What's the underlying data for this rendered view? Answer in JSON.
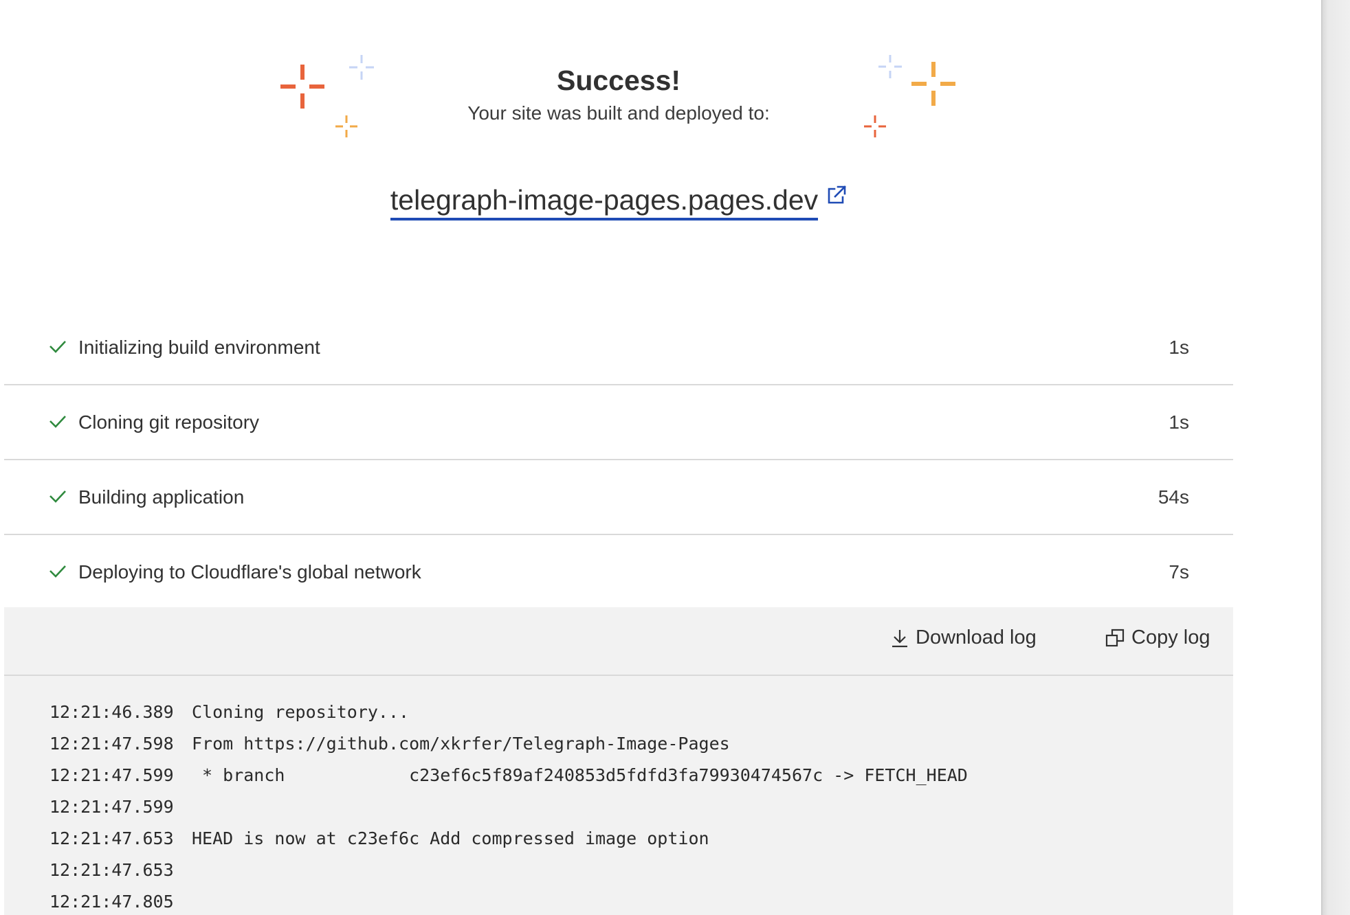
{
  "header": {
    "title": "Success!",
    "subtitle": "Your site was built and deployed to:",
    "url": "telegraph-image-pages.pages.dev",
    "sparkle_colors": {
      "orange_red": "#e8643c",
      "amber": "#f2aa48",
      "light_blue": "#c6d4f5"
    },
    "link_underline_color": "#1f4bb5"
  },
  "steps": [
    {
      "label": "Initializing build environment",
      "time": "1s",
      "status_icon": "check-icon"
    },
    {
      "label": "Cloning git repository",
      "time": "1s",
      "status_icon": "check-icon"
    },
    {
      "label": "Building application",
      "time": "54s",
      "status_icon": "check-icon"
    },
    {
      "label": "Deploying to Cloudflare's global network",
      "time": "7s",
      "status_icon": "check-icon"
    }
  ],
  "log_toolbar": {
    "download_label": "Download log",
    "copy_label": "Copy log"
  },
  "log": [
    {
      "ts": "12:21:46.389",
      "text": "Cloning repository..."
    },
    {
      "ts": "12:21:47.598",
      "text": "From https://github.com/xkrfer/Telegraph-Image-Pages"
    },
    {
      "ts": "12:21:47.599",
      "text": " * branch            c23ef6c5f89af240853d5fdfd3fa79930474567c -> FETCH_HEAD"
    },
    {
      "ts": "12:21:47.599",
      "text": ""
    },
    {
      "ts": "12:21:47.653",
      "text": "HEAD is now at c23ef6c Add compressed image option"
    },
    {
      "ts": "12:21:47.653",
      "text": ""
    },
    {
      "ts": "12:21:47.805",
      "text": ""
    }
  ],
  "colors": {
    "check_green": "#2f8a3e",
    "log_background": "#f2f2f2",
    "divider": "#d9d9d9"
  }
}
